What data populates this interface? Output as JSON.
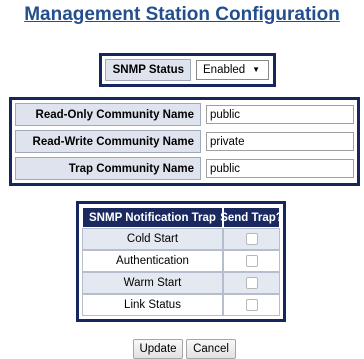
{
  "page": {
    "title": "Management Station Configuration"
  },
  "snmp": {
    "status_label": "SNMP Status",
    "status_value": "Enabled"
  },
  "community": {
    "rows": [
      {
        "label": "Read-Only Community Name",
        "value": "public"
      },
      {
        "label": "Read-Write Community Name",
        "value": "private"
      },
      {
        "label": "Trap Community Name",
        "value": "public"
      }
    ]
  },
  "traps": {
    "header_trap": "SNMP Notification Trap",
    "header_send": "Send Trap?",
    "rows": [
      {
        "name": "Cold Start",
        "checked": false
      },
      {
        "name": "Authentication",
        "checked": false
      },
      {
        "name": "Warm Start",
        "checked": false
      },
      {
        "name": "Link Status",
        "checked": false
      }
    ]
  },
  "buttons": {
    "update": "Update",
    "cancel": "Cancel"
  }
}
